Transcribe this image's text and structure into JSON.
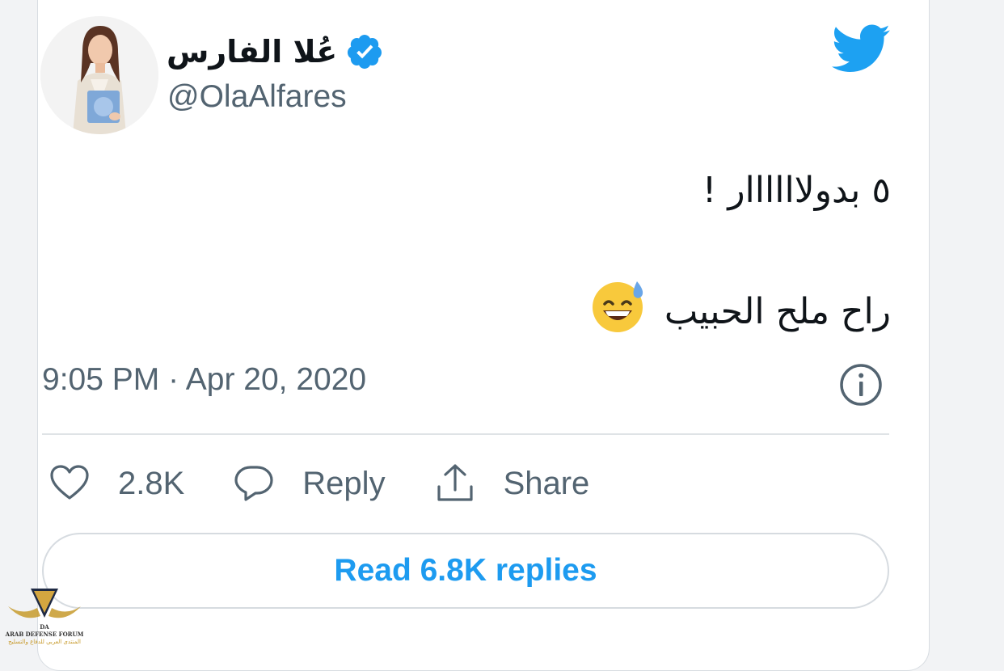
{
  "tweet": {
    "display_name": "عُلا الفارس",
    "handle": "@OlaAlfares",
    "text_line1": "٥ بدولاااااار !",
    "text_line2": "راح ملح الحبيب",
    "emoji": "grinning-face-with-sweat",
    "timestamp": "9:05 PM · Apr 20, 2020",
    "likes_count": "2.8K",
    "reply_label": "Reply",
    "share_label": "Share",
    "read_replies_label": "Read 6.8K replies"
  },
  "watermark": {
    "line1": "ARAB DEFENSE FORUM",
    "line2": "المنتدى العربي للدفاع والتسليح",
    "monogram": "DA"
  },
  "colors": {
    "accent": "#1d9bf0",
    "twitter_blue": "#1da1f2",
    "text_primary": "#0f1419",
    "text_secondary": "#536471"
  },
  "icons": {
    "verified": "verified-badge-icon",
    "bird": "twitter-bird-icon",
    "info": "info-icon",
    "like": "heart-icon",
    "reply": "speech-bubble-icon",
    "share": "share-upload-icon"
  }
}
